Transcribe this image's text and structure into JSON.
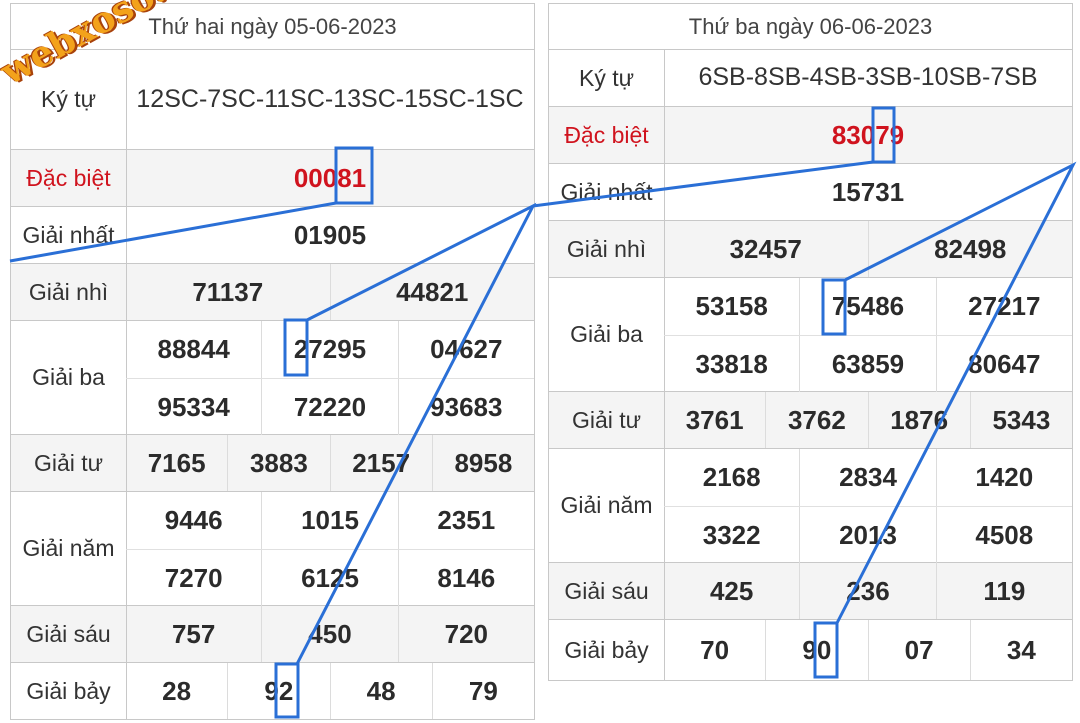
{
  "watermark": "webxoso.net",
  "colors": {
    "special": "#d0131e",
    "annotation": "#2a6fd6",
    "watermark": "#f3a21b"
  },
  "left": {
    "title": "Thứ hai ngày 05-06-2023",
    "serial_label": "Ký tự",
    "serial": "12SC-7SC-11SC-13SC-15SC-1SC",
    "special_label": "Đặc biệt",
    "special": "00081",
    "first_label": "Giải nhất",
    "first": "01905",
    "second_label": "Giải nhì",
    "second": [
      "71137",
      "44821"
    ],
    "third_label": "Giải ba",
    "third": [
      "88844",
      "27295",
      "04627",
      "95334",
      "72220",
      "93683"
    ],
    "fourth_label": "Giải tư",
    "fourth": [
      "7165",
      "3883",
      "2157",
      "8958"
    ],
    "fifth_label": "Giải năm",
    "fifth": [
      "9446",
      "1015",
      "2351",
      "7270",
      "6125",
      "8146"
    ],
    "sixth_label": "Giải sáu",
    "sixth": [
      "757",
      "450",
      "720"
    ],
    "seventh_label": "Giải bảy",
    "seventh": [
      "28",
      "92",
      "48",
      "79"
    ]
  },
  "right": {
    "title": "Thứ ba ngày 06-06-2023",
    "serial_label": "Ký tự",
    "serial": "6SB-8SB-4SB-3SB-10SB-7SB",
    "special_label": "Đặc biệt",
    "special": "83079",
    "first_label": "Giải nhất",
    "first": "15731",
    "second_label": "Giải nhì",
    "second": [
      "32457",
      "82498"
    ],
    "third_label": "Giải ba",
    "third": [
      "53158",
      "75486",
      "27217",
      "33818",
      "63859",
      "80647"
    ],
    "fourth_label": "Giải tư",
    "fourth": [
      "3761",
      "3762",
      "1876",
      "5343"
    ],
    "fifth_label": "Giải năm",
    "fifth": [
      "2168",
      "2834",
      "1420",
      "3322",
      "2013",
      "4508"
    ],
    "sixth_label": "Giải sáu",
    "sixth": [
      "425",
      "236",
      "119"
    ],
    "seventh_label": "Giải bảy",
    "seventh": [
      "70",
      "90",
      "07",
      "34"
    ]
  }
}
